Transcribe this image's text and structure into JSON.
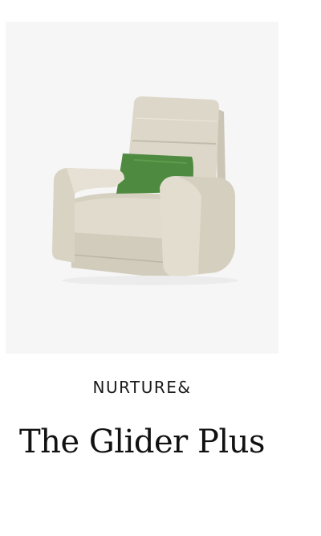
{
  "product": {
    "brand": "NURTURE&",
    "title": "The Glider Plus",
    "image_icon": "glider-chair-image"
  },
  "colors": {
    "image_background": "#f6f6f6",
    "upholstery": "#dcd6c8",
    "pillow": "#4e8a3f",
    "text": "#111111"
  }
}
